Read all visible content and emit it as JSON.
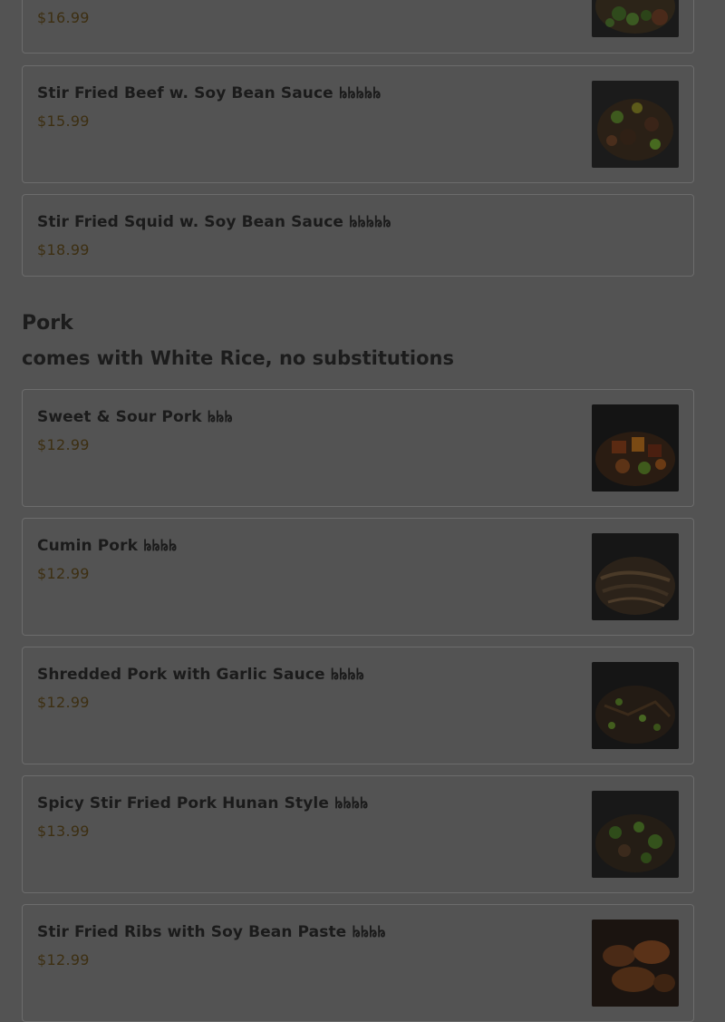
{
  "sections": [
    {
      "items": [
        {
          "price": "$16.99",
          "image": "dish-photo"
        },
        {
          "name": "Stir Fried Beef w. Soy Bean Sauce 𖫂𖫂𖫂𖫂𖫂",
          "price": "$15.99",
          "image": "dish-photo"
        },
        {
          "name": "Stir Fried Squid w. Soy Bean Sauce 𖫂𖫂𖫂𖫂𖫂",
          "price": "$18.99"
        }
      ]
    },
    {
      "title": "Pork",
      "subtitle": "comes with White Rice, no substitutions",
      "items": [
        {
          "name": "Sweet & Sour Pork 𖫂𖫂𖫂",
          "price": "$12.99",
          "image": "dish-photo"
        },
        {
          "name": "Cumin Pork 𖫂𖫂𖫂𖫂",
          "price": "$12.99",
          "image": "dish-photo"
        },
        {
          "name": "Shredded Pork with Garlic Sauce 𖫂𖫂𖫂𖫂",
          "price": "$12.99",
          "image": "dish-photo"
        },
        {
          "name": "Spicy Stir Fried Pork Hunan Style 𖫂𖫂𖫂𖫂",
          "price": "$13.99",
          "image": "dish-photo"
        },
        {
          "name": "Stir Fried Ribs with Soy Bean Paste 𖫂𖫂𖫂𖫂",
          "price": "$12.99",
          "image": "dish-photo"
        }
      ]
    }
  ],
  "colors": {
    "overlay_background": "#535353",
    "card_border": "#6c6c6c",
    "price_text": "#3d2f12"
  }
}
